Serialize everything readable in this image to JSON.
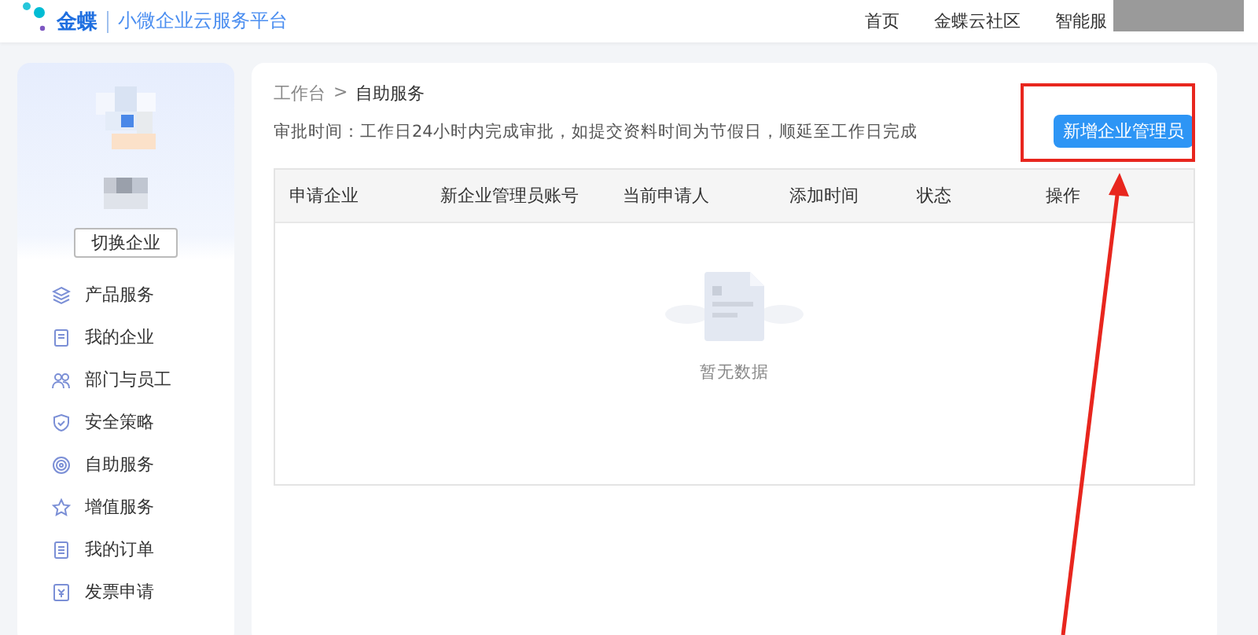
{
  "header": {
    "brand": "金蝶",
    "platform": "小微企业云服务平台",
    "nav": [
      {
        "label": "首页",
        "selected": false
      },
      {
        "label": "金蝶云社区",
        "selected": false
      },
      {
        "label": "智能服",
        "selected": false
      }
    ]
  },
  "sidebar": {
    "switch_button": "切换企业",
    "items": [
      {
        "label": "产品服务",
        "selected": false
      },
      {
        "label": "我的企业",
        "selected": false
      },
      {
        "label": "部门与员工",
        "selected": false
      },
      {
        "label": "安全策略",
        "selected": false
      },
      {
        "label": "自助服务",
        "selected": false
      },
      {
        "label": "增值服务",
        "selected": false
      },
      {
        "label": "我的订单",
        "selected": false
      },
      {
        "label": "发票申请",
        "selected": false
      }
    ]
  },
  "breadcrumb": {
    "items": [
      "工作台",
      "自助服务"
    ],
    "separator": ">"
  },
  "notice": "审批时间：工作日24小时内完成审批，如提交资料时间为节假日，顺延至工作日完成",
  "add_button": "新增企业管理员",
  "table": {
    "columns": [
      "申请企业",
      "新企业管理员账号",
      "当前申请人",
      "添加时间",
      "状态",
      "操作"
    ],
    "empty_text": "暂无数据"
  }
}
